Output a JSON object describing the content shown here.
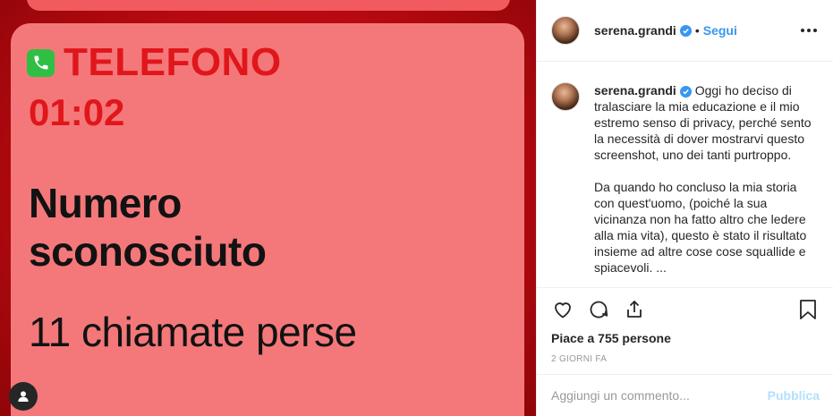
{
  "image": {
    "app_name": "TELEFONO",
    "time": "01:02",
    "caller_line1": "Numero",
    "caller_line2": "sconosciuto",
    "missed_calls": "11 chiamate perse",
    "app_icon": "phone-icon",
    "colors": {
      "background": "#c20c12",
      "card": "#f4787a",
      "accent_text": "#e0161b",
      "phone_icon": "#2fbf44"
    }
  },
  "header": {
    "username": "serena.grandi",
    "separator": "•",
    "follow_label": "Segui",
    "more_icon": "ellipsis-icon"
  },
  "caption": {
    "username": "serena.grandi",
    "paragraph1": "Oggi ho deciso di tralasciare la mia educazione e il mio estremo senso di privacy, perché sento la necessità di dover mostrarvi questo screenshot, uno dei tanti purtroppo.",
    "paragraph2": "Da quando ho concluso la mia storia con quest'uomo, (poiché la sua vicinanza non ha fatto altro che ledere alla mia vita), questo è stato il risultato insieme ad altre cose cose squallide e spiacevoli. ..."
  },
  "actions": {
    "likes": "Piace a 755 persone",
    "timestamp": "2 GIORNI FA",
    "icons": [
      "heart-icon",
      "comment-icon",
      "share-icon",
      "bookmark-icon"
    ]
  },
  "comment_box": {
    "placeholder": "Aggiungi un commento...",
    "publish_label": "Pubblica"
  },
  "colors": {
    "link": "#3897f0",
    "publish_disabled": "#b2dffc",
    "text": "#262626",
    "muted": "#999999"
  }
}
